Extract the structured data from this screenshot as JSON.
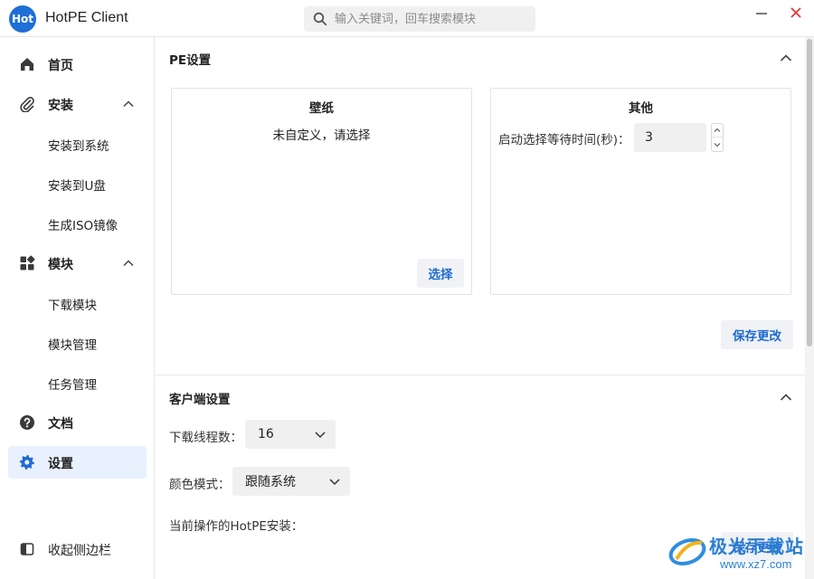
{
  "app": {
    "logo_text": "Hot",
    "title": "HotPE Client"
  },
  "search": {
    "placeholder": "输入关键词，回车搜索模块"
  },
  "sidebar": {
    "items": [
      {
        "label": "首页",
        "icon": "home-icon"
      },
      {
        "label": "安装",
        "icon": "paperclip-icon"
      },
      {
        "label": "安装到系统"
      },
      {
        "label": "安装到U盘"
      },
      {
        "label": "生成ISO镜像"
      },
      {
        "label": "模块",
        "icon": "grid-icon"
      },
      {
        "label": "下载模块"
      },
      {
        "label": "模块管理"
      },
      {
        "label": "任务管理"
      },
      {
        "label": "文档",
        "icon": "help-icon"
      },
      {
        "label": "设置",
        "icon": "gear-icon",
        "active": true
      }
    ],
    "collapse_label": "收起侧边栏"
  },
  "pe_settings": {
    "title": "PE设置",
    "wallpaper": {
      "title": "壁纸",
      "status": "未自定义，请选择",
      "select_button": "选择"
    },
    "other": {
      "title": "其他",
      "wait_label": "启动选择等待时间(秒)：",
      "wait_value": "3"
    },
    "save_button": "保存更改"
  },
  "client_settings": {
    "title": "客户端设置",
    "threads_label": "下载线程数：",
    "threads_value": "16",
    "color_label": "颜色模式：",
    "color_value": "跟随系统",
    "install_label": "当前操作的HotPE安装：",
    "save_button": "保存更改"
  },
  "watermark": {
    "text": "极光下载站",
    "url": "www.xz7.com"
  },
  "colors": {
    "accent": "#1f6bd1",
    "active_bg": "#e8f1fd",
    "close": "#e53935"
  }
}
